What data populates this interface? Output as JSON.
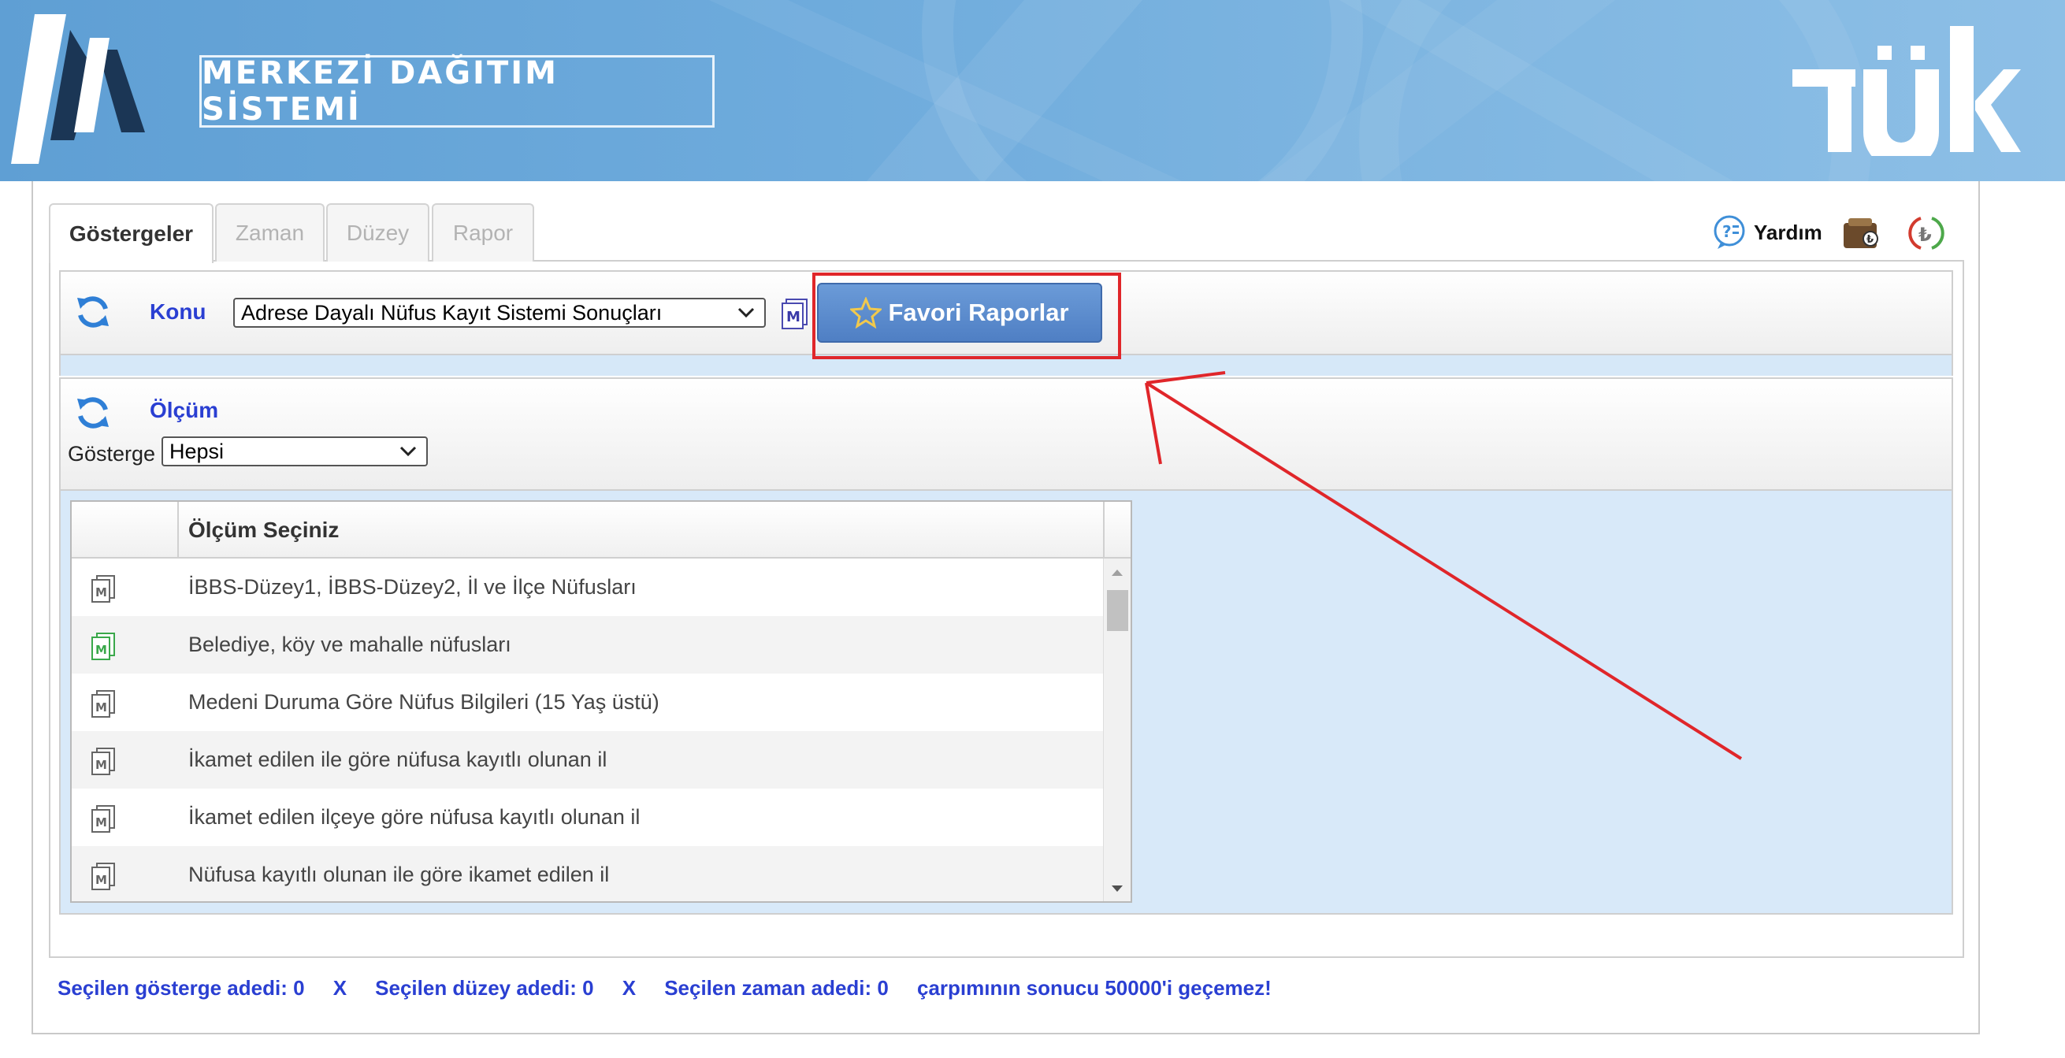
{
  "header": {
    "brand_title": "MERKEZİ DAĞITIM SİSTEMİ",
    "left_logo": "mds-logo",
    "right_logo": "tuik-logo"
  },
  "tabs": [
    {
      "label": "Göstergeler",
      "active": true
    },
    {
      "label": "Zaman",
      "active": false
    },
    {
      "label": "Düzey",
      "active": false
    },
    {
      "label": "Rapor",
      "active": false
    }
  ],
  "toolbar": {
    "help_label": "Yardım",
    "help_icon": "help-chat-icon",
    "wallet_icon": "wallet-icon",
    "currency_icon": "lira-icon"
  },
  "konu": {
    "label": "Konu",
    "selected": "Adrese Dayalı Nüfus Kayıt Sistemi Sonuçları",
    "favorites_button": "Favori Raporlar"
  },
  "olcum": {
    "label": "Ölçüm",
    "gosterge_label": "Gösterge",
    "gosterge_selected": "Hepsi"
  },
  "grid": {
    "header": "Ölçüm Seçiniz",
    "rows": [
      {
        "label": "İBBS-Düzey1, İBBS-Düzey2, İl ve İlçe Nüfusları",
        "icon": "metadata-doc-icon",
        "icon_color": "#666666"
      },
      {
        "label": "Belediye, köy ve mahalle nüfusları",
        "icon": "metadata-doc-icon",
        "icon_color": "#3aa84a"
      },
      {
        "label": "Medeni Duruma Göre Nüfus Bilgileri (15 Yaş üstü)",
        "icon": "metadata-doc-icon",
        "icon_color": "#666666"
      },
      {
        "label": "İkamet edilen ile göre nüfusa kayıtlı olunan il",
        "icon": "metadata-doc-icon",
        "icon_color": "#666666"
      },
      {
        "label": "İkamet edilen ilçeye göre nüfusa kayıtlı olunan il",
        "icon": "metadata-doc-icon",
        "icon_color": "#666666"
      },
      {
        "label": "Nüfusa kayıtlı olunan ile göre ikamet edilen il",
        "icon": "metadata-doc-icon",
        "icon_color": "#666666"
      }
    ]
  },
  "footer": {
    "gosterge_count": "Seçilen gösterge adedi: 0",
    "sep1": "X",
    "duzey_count": "Seçilen düzey adedi: 0",
    "sep2": "X",
    "zaman_count": "Seçilen zaman adedi: 0",
    "limit_text": "çarpımının sonucu 50000'i geçemez!"
  },
  "colors": {
    "accent_blue": "#2a3fd2",
    "highlight_red": "#e0262a",
    "button_blue": "#5a8acd"
  }
}
